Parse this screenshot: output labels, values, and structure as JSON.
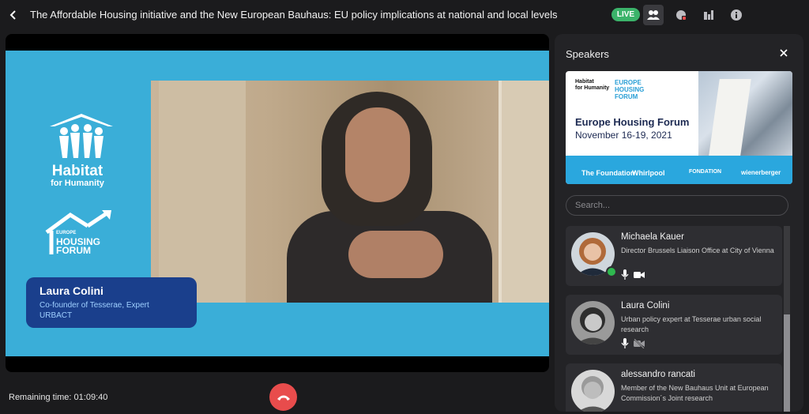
{
  "header": {
    "title": "The Affordable Housing initiative and the New European Bauhaus: EU policy implications at national and local levels",
    "live_label": "LIVE"
  },
  "stage": {
    "slide": {
      "habitat_line1": "Habitat",
      "habitat_line2": "for Humanity",
      "ehf_small": "EUROPE",
      "ehf_line1": "HOUSING",
      "ehf_line2": "FORUM"
    },
    "speaker_name": "Laura Colini",
    "speaker_role": "Co-founder of Tesserae, Expert URBACT"
  },
  "footer": {
    "remaining_label": "Remaining time:",
    "remaining_value": "01:09:40"
  },
  "panel": {
    "title": "Speakers",
    "banner": {
      "org1_line1": "Habitat",
      "org1_line2": "for Humanity",
      "org2_small": "EUROPE",
      "org2_line1": "HOUSING",
      "org2_line2": "FORUM",
      "event_title": "Europe Housing Forum",
      "event_dates": "November 16-19, 2021",
      "sponsors": [
        "The Foundation",
        "Whirlpool",
        "FONDATION",
        "wienerberger"
      ]
    },
    "search_placeholder": "Search...",
    "speakers": [
      {
        "name": "Michaela Kauer",
        "role": "Director Brussels Liaison Office at City of Vienna",
        "online": true,
        "mic": true,
        "video": true
      },
      {
        "name": "Laura Colini",
        "role": "Urban policy expert at Tesserae urban social research",
        "online": false,
        "mic": true,
        "video": false
      },
      {
        "name": "alessandro rancati",
        "role": "Member of the New Bauhaus Unit at European Commission´s Joint research",
        "online": false,
        "mic": false,
        "video": false
      }
    ]
  },
  "colors": {
    "live": "#3bb36a",
    "slide_bg": "#3aaed8",
    "name_card": "#1a3f8c",
    "end_call": "#e84c4c",
    "online": "#2fb84f"
  }
}
